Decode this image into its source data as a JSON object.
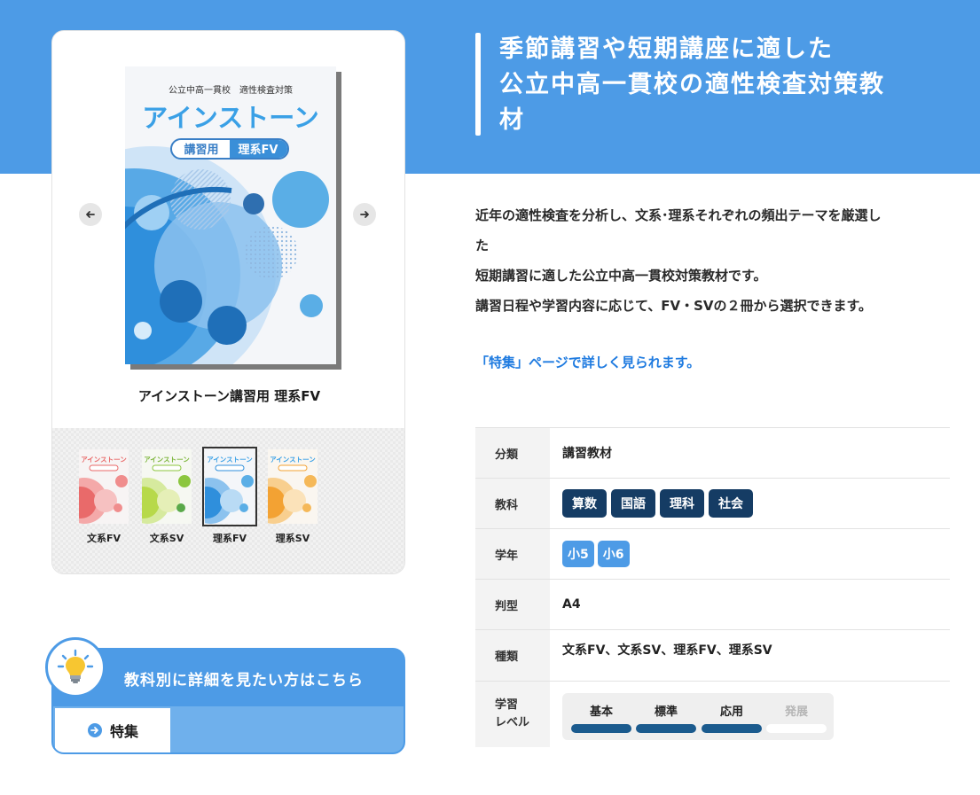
{
  "colors": {
    "brand_blue": "#4d9be6",
    "navy": "#153c64",
    "link": "#1f7be0"
  },
  "headline": {
    "line1": "季節講習や短期講座に適した",
    "line2": "公立中高一貫校の適性検査対策教",
    "line3": "材"
  },
  "product": {
    "title": "アインストーン講習用 理系FV",
    "cover": {
      "series": "公立中高一貫校　適性検査対策",
      "brand": "アインストーン",
      "badge_left": "講習用",
      "badge_right": "理系FV"
    },
    "prev_icon": "arrow-left-icon",
    "next_icon": "arrow-right-icon",
    "thumbnails": [
      {
        "label": "文系FV",
        "color": "#e96a6a",
        "selected": false
      },
      {
        "label": "文系SV",
        "color": "#8cc63f",
        "selected": false
      },
      {
        "label": "理系FV",
        "color": "#2f8fdc",
        "selected": true
      },
      {
        "label": "理系SV",
        "color": "#f3a233",
        "selected": false
      }
    ]
  },
  "description": {
    "line1": "近年の適性検査を分析し、文系･理系それぞれの頻出テーマを厳選し",
    "line2": "た",
    "line3": "短期講習に適した公立中高一貫校対策教材です。",
    "line4": "講習日程や学習内容に応じて、FV・SVの２冊から選択できます。"
  },
  "feature_link": "「特集」ページで詳しく見られます。",
  "spec": {
    "category": {
      "label": "分類",
      "value": "講習教材"
    },
    "subjects": {
      "label": "教科",
      "values": [
        "算数",
        "国語",
        "理科",
        "社会"
      ]
    },
    "grades": {
      "label": "学年",
      "values": [
        "小5",
        "小6"
      ]
    },
    "size": {
      "label": "判型",
      "value": "A4"
    },
    "kind": {
      "label": "種類",
      "value": "文系FV、文系SV、理系FV、理系SV"
    },
    "level": {
      "label_line1": "学習",
      "label_line2": "レベル",
      "items": [
        {
          "name": "基本",
          "active": true
        },
        {
          "name": "標準",
          "active": true
        },
        {
          "name": "応用",
          "active": true
        },
        {
          "name": "発展",
          "active": false
        }
      ]
    }
  },
  "subject_box": {
    "heading": "教科別に詳細を見たい方はこちら",
    "button_label": "特集",
    "icon": "lightbulb-icon"
  }
}
